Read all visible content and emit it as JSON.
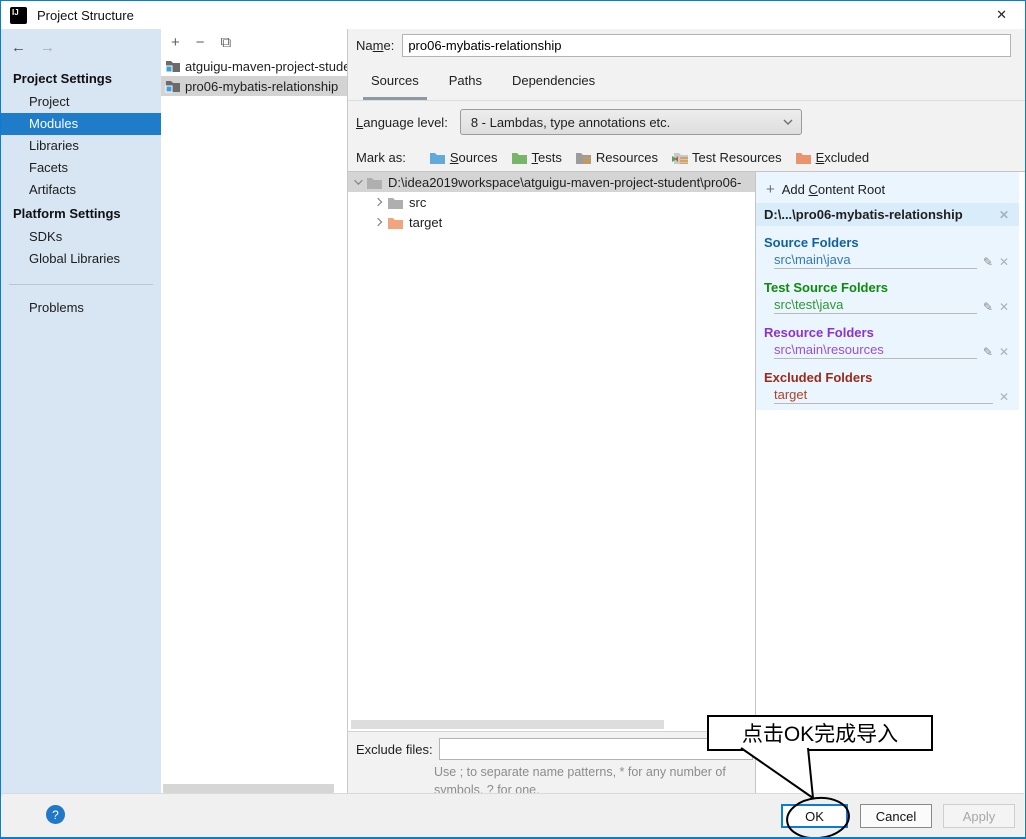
{
  "window": {
    "title": "Project Structure"
  },
  "icons": {
    "close": "✕",
    "back_arrow": "←",
    "fwd_arrow": "→",
    "plus": "+",
    "minus": "−",
    "copy": "⧉",
    "pencil": "✎",
    "x_small": "✕",
    "help": "?"
  },
  "sidebar": {
    "section1_header": "Project Settings",
    "section1_items": [
      "Project",
      "Modules",
      "Libraries",
      "Facets",
      "Artifacts"
    ],
    "section2_header": "Platform Settings",
    "section2_items": [
      "SDKs",
      "Global Libraries"
    ],
    "problems_item": "Problems",
    "selected_item": "Modules"
  },
  "module_list": {
    "items": [
      "atguigu-maven-project-stude",
      "pro06-mybatis-relationship"
    ],
    "selected": "pro06-mybatis-relationship"
  },
  "editor": {
    "name_label": "Name:",
    "name_value": "pro06-mybatis-relationship",
    "tabs": {
      "sources": "Sources",
      "paths": "Paths",
      "dependencies": "Dependencies"
    },
    "selected_tab": "Sources",
    "language_level_label": "Language level:",
    "language_level_value": "8 - Lambdas, type annotations etc.",
    "mark_as_label": "Mark as:",
    "mark_sources": "Sources",
    "mark_tests": "Tests",
    "mark_resources": "Resources",
    "mark_test_resources": "Test Resources",
    "mark_excluded": "Excluded",
    "tree": {
      "root": "D:\\idea2019workspace\\atguigu-maven-project-student\\pro06-",
      "child1": "src",
      "child2": "target"
    },
    "exclude_label": "Exclude files:",
    "exclude_value": "",
    "exclude_hint": "Use ; to separate name patterns, * for any number of symbols, ? for one."
  },
  "content_pane": {
    "add_content_root": "Add Content Root",
    "root_path": "D:\\...\\pro06-mybatis-relationship",
    "groups": [
      {
        "title": "Source Folders",
        "value": "src\\main\\java",
        "title_color": "#10629F",
        "value_color": "#3279B5"
      },
      {
        "title": "Test Source Folders",
        "value": "src\\test\\java",
        "title_color": "#0F8A0F",
        "value_color": "#2F9636"
      },
      {
        "title": "Resource Folders",
        "value": "src\\main\\resources",
        "title_color": "#8B32D2",
        "value_color": "#9850D6"
      },
      {
        "title": "Excluded Folders",
        "value": "target",
        "title_color": "#9A2B1A",
        "value_color": "#A9452C"
      }
    ]
  },
  "callout": {
    "text": "点击OK完成导入"
  },
  "footer": {
    "ok": "OK",
    "cancel": "Cancel",
    "apply": "Apply"
  },
  "colors": {
    "window_border": "#0A7CD8",
    "sidebar_bg": "#D8E5F2",
    "selection_blue": "#1E7CC8",
    "panel_bg": "#EAF5FD",
    "root_row_bg": "#D9ECFA",
    "tree_selection": "#D4D4D4",
    "footer_bg": "#F0F0F0"
  }
}
